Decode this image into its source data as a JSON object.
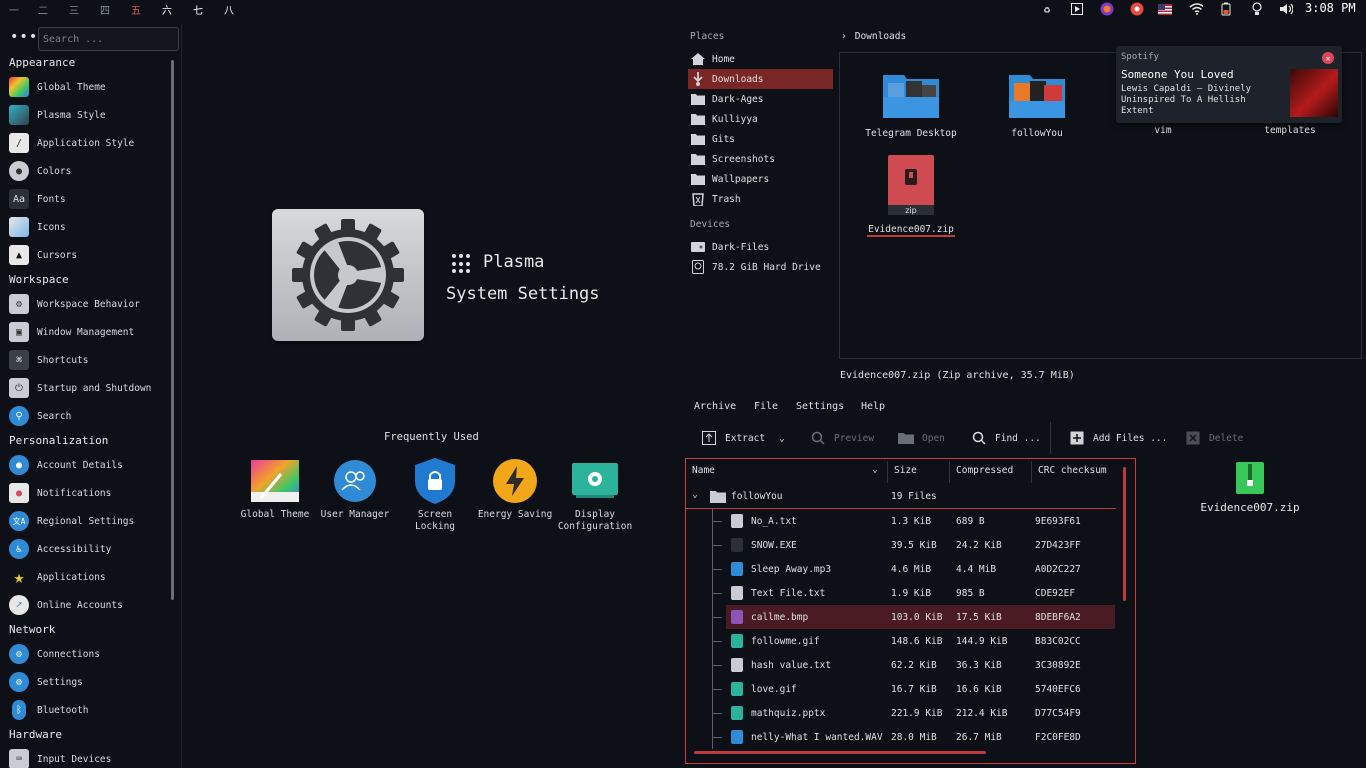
{
  "top_panel": {
    "workspaces": [
      "一",
      "二",
      "三",
      "四",
      "五",
      "六",
      "七",
      "八"
    ],
    "active_workspace": "五",
    "clock": "3:08 PM"
  },
  "sidebar": {
    "search_placeholder": "Search ...",
    "sections": [
      {
        "title": "Appearance",
        "items": [
          "Global Theme",
          "Plasma Style",
          "Application Style",
          "Colors",
          "Fonts",
          "Icons",
          "Cursors"
        ]
      },
      {
        "title": "Workspace",
        "items": [
          "Workspace Behavior",
          "Window Management",
          "Shortcuts",
          "Startup and Shutdown",
          "Search"
        ]
      },
      {
        "title": "Personalization",
        "items": [
          "Account Details",
          "Notifications",
          "Regional Settings",
          "Accessibility",
          "Applications",
          "Online Accounts"
        ]
      },
      {
        "title": "Network",
        "items": [
          "Connections",
          "Settings",
          "Bluetooth"
        ]
      },
      {
        "title": "Hardware",
        "items": [
          "Input Devices"
        ]
      }
    ]
  },
  "center": {
    "title": "Plasma",
    "subtitle": "System Settings",
    "frequently_used_title": "Frequently Used",
    "frequent": [
      "Global Theme",
      "User Manager",
      "Screen Locking",
      "Energy Saving",
      "Display Configuration"
    ]
  },
  "file_manager": {
    "places_title": "Places",
    "places": [
      "Home",
      "Downloads",
      "Dark-Ages",
      "Kulliyya",
      "Gits",
      "Screenshots",
      "Wallpapers",
      "Trash"
    ],
    "selected_place": "Downloads",
    "devices_title": "Devices",
    "devices": [
      "Dark-Files",
      "78.2 GiB Hard Drive"
    ],
    "breadcrumb": "Downloads",
    "files": [
      "Telegram Desktop",
      "followYou",
      "vim",
      "templates",
      "Evidence007.zip"
    ],
    "zip_badge": "zip",
    "status": "Evidence007.zip (Zip archive, 35.7 MiB)"
  },
  "notification": {
    "app": "Spotify",
    "title": "Someone You Loved",
    "body": "Lewis Capaldi – Divinely Uninspired To A Hellish Extent"
  },
  "ark": {
    "menu": [
      "Archive",
      "File",
      "Settings",
      "Help"
    ],
    "toolbar": {
      "extract": "Extract",
      "preview": "Preview",
      "open": "Open",
      "find": "Find ...",
      "add_files": "Add Files ...",
      "delete": "Delete"
    },
    "columns": [
      "Name",
      "Size",
      "Compressed",
      "CRC checksum"
    ],
    "root": {
      "name": "followYou",
      "size": "19 Files"
    },
    "rows": [
      {
        "name": "No_A.txt",
        "size": "1.3 KiB",
        "compressed": "689 B",
        "crc": "9E693F61",
        "color": "#c9ccd2"
      },
      {
        "name": "SNOW.EXE",
        "size": "39.5 KiB",
        "compressed": "24.2 KiB",
        "crc": "27D423FF",
        "color": "#2b2f36"
      },
      {
        "name": "Sleep Away.mp3",
        "size": "4.6 MiB",
        "compressed": "4.4 MiB",
        "crc": "A0D2C227",
        "color": "#2f8bd6"
      },
      {
        "name": "Text File.txt",
        "size": "1.9 KiB",
        "compressed": "985 B",
        "crc": "CDE92EF",
        "color": "#c9ccd2"
      },
      {
        "name": "callme.bmp",
        "size": "103.0 KiB",
        "compressed": "17.5 KiB",
        "crc": "8DEBF6A2",
        "color": "#8e54b8"
      },
      {
        "name": "followme.gif",
        "size": "148.6 KiB",
        "compressed": "144.9 KiB",
        "crc": "B83C02CC",
        "color": "#2bb39c"
      },
      {
        "name": "hash value.txt",
        "size": "62.2 KiB",
        "compressed": "36.3 KiB",
        "crc": "3C30892E",
        "color": "#c9ccd2"
      },
      {
        "name": "love.gif",
        "size": "16.7 KiB",
        "compressed": "16.6 KiB",
        "crc": "5740EFC6",
        "color": "#2bb39c"
      },
      {
        "name": "mathquiz.pptx",
        "size": "221.9 KiB",
        "compressed": "212.4 KiB",
        "crc": "D77C54F9",
        "color": "#2bb39c"
      },
      {
        "name": "nelly-What I wanted.WAV",
        "size": "28.0 MiB",
        "compressed": "26.7 MiB",
        "crc": "F2C0FE8D",
        "color": "#2f8bd6"
      }
    ],
    "selected_row": "callme.bmp",
    "side_archive": "Evidence007.zip"
  }
}
